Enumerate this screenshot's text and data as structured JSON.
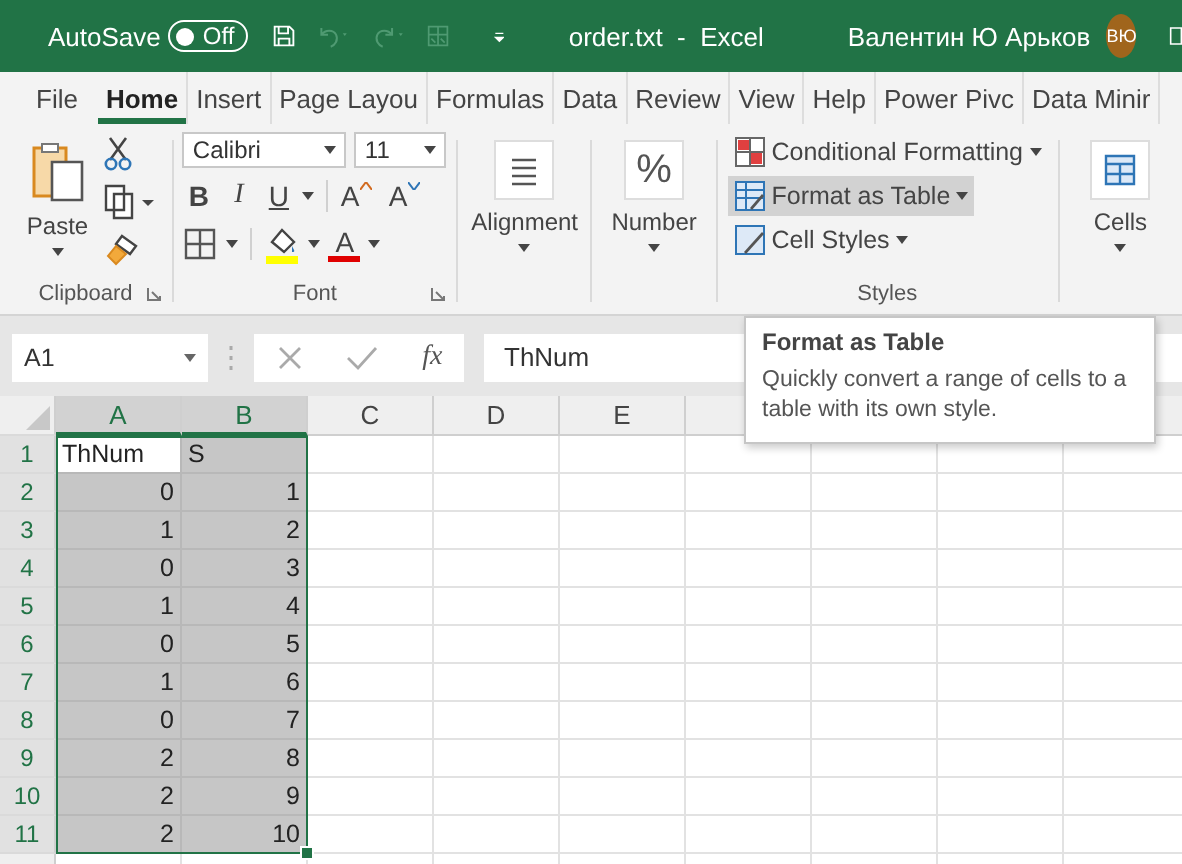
{
  "title_bar": {
    "autosave_label": "AutoSave",
    "autosave": {
      "label": "Off",
      "on": false
    },
    "quick_access": [
      {
        "kind": "save",
        "disabled": false
      },
      {
        "kind": "undo",
        "disabled": true
      },
      {
        "kind": "redo",
        "disabled": true
      },
      {
        "kind": "form",
        "disabled": true
      }
    ],
    "document_title": "order.txt  -  Excel",
    "user_name": "Валентин Ю Арьков",
    "avatar": "ВЮ"
  },
  "tabs": [
    {
      "label": "File",
      "selected": false
    },
    {
      "label": "Home",
      "selected": true
    },
    {
      "label": "Insert",
      "selected": false
    },
    {
      "label": "Page Layou",
      "selected": false
    },
    {
      "label": "Formulas",
      "selected": false
    },
    {
      "label": "Data",
      "selected": false
    },
    {
      "label": "Review",
      "selected": false
    },
    {
      "label": "View",
      "selected": false
    },
    {
      "label": "Help",
      "selected": false
    },
    {
      "label": "Power Pivc",
      "selected": false
    },
    {
      "label": "Data Minir",
      "selected": false
    }
  ],
  "ribbon": {
    "clipboard": {
      "paste": "Paste",
      "label": "Clipboard"
    },
    "font": {
      "name": "Calibri",
      "size": "11",
      "label": "Font",
      "buttons": [
        {
          "kind": "bold",
          "text": "B"
        },
        {
          "kind": "italic",
          "text": "I"
        },
        {
          "kind": "underline",
          "text": "U"
        },
        {
          "kind": "grow",
          "text": "A"
        },
        {
          "kind": "shrink",
          "text": "A"
        }
      ],
      "font_color_text": "A"
    },
    "alignment": {
      "label": "Alignment"
    },
    "number": {
      "label": "Number",
      "symbol": "%"
    },
    "styles": {
      "label": "Styles",
      "items": [
        {
          "kind": "conditional",
          "label": "Conditional Formatting",
          "selected": false
        },
        {
          "kind": "table",
          "label": "Format as Table",
          "selected": true
        },
        {
          "kind": "cell",
          "label": "Cell Styles",
          "selected": false
        }
      ]
    },
    "cells": {
      "label": "Cells"
    }
  },
  "formula_bar": {
    "name_box": "A1",
    "fx": "fx",
    "value": "ThNum"
  },
  "sheet": {
    "columns": [
      {
        "label": "A",
        "selected": true
      },
      {
        "label": "B",
        "selected": true
      },
      {
        "label": "C",
        "selected": false
      },
      {
        "label": "D",
        "selected": false
      },
      {
        "label": "E",
        "selected": false
      }
    ],
    "rows": [
      {
        "number": "1",
        "cells": [
          {
            "text": "ThNum",
            "kind": "text",
            "selected": true,
            "active": true
          },
          {
            "text": "S",
            "kind": "text",
            "selected": true,
            "active": false
          }
        ]
      },
      {
        "number": "2",
        "cells": [
          {
            "text": "0",
            "kind": "number",
            "selected": true,
            "active": false
          },
          {
            "text": "1",
            "kind": "number",
            "selected": true,
            "active": false
          }
        ]
      },
      {
        "number": "3",
        "cells": [
          {
            "text": "1",
            "kind": "number",
            "selected": true,
            "active": false
          },
          {
            "text": "2",
            "kind": "number",
            "selected": true,
            "active": false
          }
        ]
      },
      {
        "number": "4",
        "cells": [
          {
            "text": "0",
            "kind": "number",
            "selected": true,
            "active": false
          },
          {
            "text": "3",
            "kind": "number",
            "selected": true,
            "active": false
          }
        ]
      },
      {
        "number": "5",
        "cells": [
          {
            "text": "1",
            "kind": "number",
            "selected": true,
            "active": false
          },
          {
            "text": "4",
            "kind": "number",
            "selected": true,
            "active": false
          }
        ]
      },
      {
        "number": "6",
        "cells": [
          {
            "text": "0",
            "kind": "number",
            "selected": true,
            "active": false
          },
          {
            "text": "5",
            "kind": "number",
            "selected": true,
            "active": false
          }
        ]
      },
      {
        "number": "7",
        "cells": [
          {
            "text": "1",
            "kind": "number",
            "selected": true,
            "active": false
          },
          {
            "text": "6",
            "kind": "number",
            "selected": true,
            "active": false
          }
        ]
      },
      {
        "number": "8",
        "cells": [
          {
            "text": "0",
            "kind": "number",
            "selected": true,
            "active": false
          },
          {
            "text": "7",
            "kind": "number",
            "selected": true,
            "active": false
          }
        ]
      },
      {
        "number": "9",
        "cells": [
          {
            "text": "2",
            "kind": "number",
            "selected": true,
            "active": false
          },
          {
            "text": "8",
            "kind": "number",
            "selected": true,
            "active": false
          }
        ]
      },
      {
        "number": "10",
        "cells": [
          {
            "text": "2",
            "kind": "number",
            "selected": true,
            "active": false
          },
          {
            "text": "9",
            "kind": "number",
            "selected": true,
            "active": false
          }
        ]
      },
      {
        "number": "11",
        "cells": [
          {
            "text": "2",
            "kind": "number",
            "selected": true,
            "active": false
          },
          {
            "text": "10",
            "kind": "number",
            "selected": true,
            "active": false
          }
        ]
      }
    ]
  },
  "tooltip": {
    "title": "Format as Table",
    "text": "Quickly convert a range of cells to a table with its own style."
  }
}
